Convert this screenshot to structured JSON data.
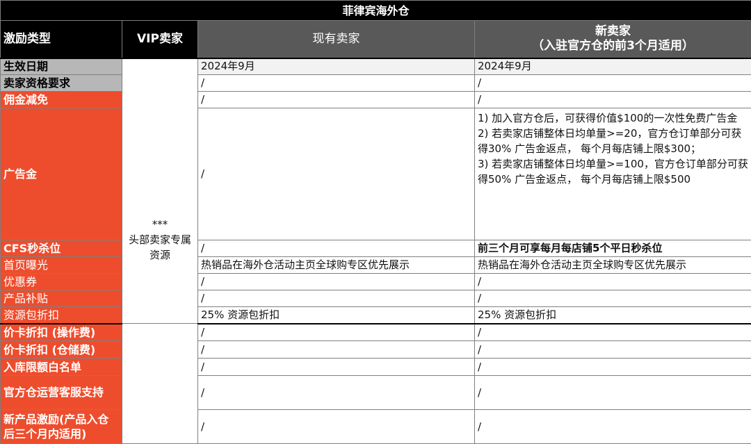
{
  "title": "菲律宾海外仓",
  "headers": {
    "incentive_type": "激励类型",
    "vip": "VIP卖家",
    "existing": "现有卖家",
    "new_line1": "新卖家",
    "new_line2": "（入驻官方仓的前3个月适用）"
  },
  "vip_cell": {
    "stars": "***",
    "text": "头部卖家专属资源"
  },
  "rows": [
    {
      "label": "生效日期",
      "existing": "2024年9月",
      "new": "2024年9月"
    },
    {
      "label": "卖家资格要求",
      "existing": "/",
      "new": "/"
    },
    {
      "label": "佣金减免",
      "existing": "/",
      "new": "/"
    },
    {
      "label": "广告金",
      "existing": "/",
      "new_lines": [
        "1) 加入官方仓后，可获得价值$100的一次性免费广告金",
        "2) 若卖家店铺整体日均单量>=20，官方仓订单部分可获得30% 广告金返点， 每个月每店铺上限$300；",
        "3) 若卖家店铺整体日均单量>=100，官方仓订单部分可获得50% 广告金返点， 每个月每店铺上限$500"
      ]
    },
    {
      "label": "CFS秒杀位",
      "existing": "/",
      "new": "前三个月可享每月每店铺5个平日秒杀位"
    },
    {
      "label": "首页曝光",
      "existing": "热销品在海外仓活动主页全球购专区优先展示",
      "new": "热销品在海外仓活动主页全球购专区优先展示"
    },
    {
      "label": "优惠券",
      "existing": "/",
      "new": "/"
    },
    {
      "label": "产品补贴",
      "existing": "/",
      "new": "/"
    },
    {
      "label": "资源包折扣",
      "existing": "25% 资源包折扣",
      "new": "25% 资源包折扣"
    },
    {
      "label": "价卡折扣 (操作费)",
      "existing": "/",
      "new": "/"
    },
    {
      "label": "价卡折扣 (仓储费)",
      "existing": "/",
      "new": "/"
    },
    {
      "label": "入库限额白名单",
      "existing": "/",
      "new": "/"
    },
    {
      "label": "官方仓运营客服支持",
      "existing": "/",
      "new": "/"
    },
    {
      "label": "新产品激励(产品入仓后三个月内适用)",
      "existing": "/",
      "new": "/"
    }
  ],
  "colors": {
    "title_bg": "#000000",
    "header_gray": "#595959",
    "label_gray": "#b7b7b7",
    "label_orange": "#ee4d2d"
  }
}
